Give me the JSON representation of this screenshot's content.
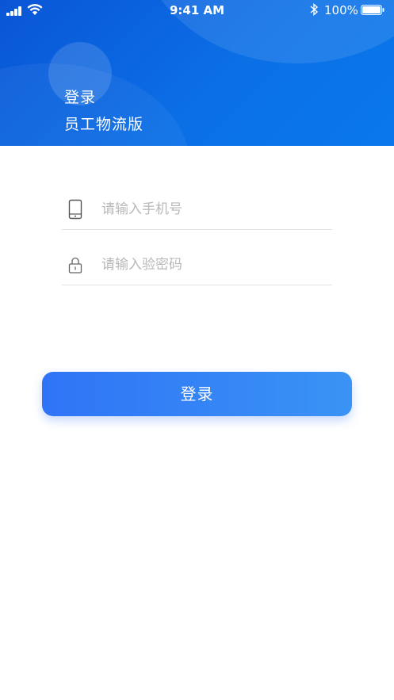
{
  "status_bar": {
    "time": "9:41 AM",
    "battery": "100%"
  },
  "header": {
    "title": "登录",
    "subtitle": "员工物流版"
  },
  "form": {
    "phone_placeholder": "请输入手机号",
    "code_placeholder": "请输入验密码",
    "phone_icon": "phone-icon",
    "lock_icon": "lock-icon"
  },
  "login_button": {
    "label": "登录"
  },
  "colors": {
    "header_start": "#0a55d6",
    "header_end": "#0a78ec",
    "button_start": "#2f74f6",
    "button_end": "#3a93f5"
  }
}
